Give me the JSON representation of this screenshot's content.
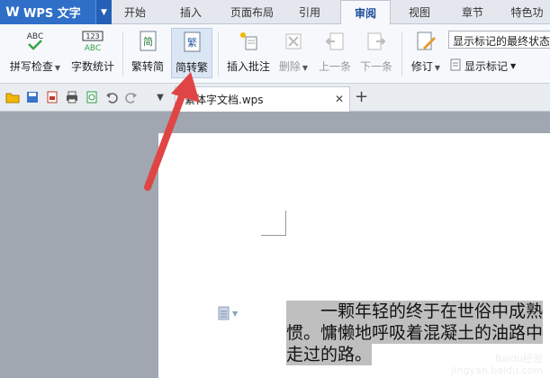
{
  "app": {
    "name": "WPS 文字",
    "logo": "W"
  },
  "menu_tabs": [
    {
      "label": "开始"
    },
    {
      "label": "插入"
    },
    {
      "label": "页面布局"
    },
    {
      "label": "引用"
    },
    {
      "label": "审阅"
    },
    {
      "label": "视图"
    },
    {
      "label": "章节"
    },
    {
      "label": "特色功"
    }
  ],
  "active_tab": "审阅",
  "ribbon": {
    "spell_check": "拼写检查",
    "word_count": "字数统计",
    "to_traditional": "繁转简",
    "to_simplified": "简转繁",
    "insert_comment": "插入批注",
    "delete": "删除",
    "prev": "上一条",
    "next": "下一条",
    "revise": "修订",
    "show_markup_select": "显示标记的最终状态",
    "show_markup": "显示标记",
    "icon_abc": "ABC",
    "icon_123": "123",
    "icon_jian": "简",
    "icon_fan": "繁"
  },
  "doc_tab": {
    "title": "繁体字文档.wps"
  },
  "document": {
    "lines": [
      "　　一颗年轻的终于在世俗中成熟",
      "惯。慵懒地呼吸着混凝土的油路中",
      "走过的路。"
    ]
  },
  "watermark": {
    "line1": "Baidu经验",
    "line2": "jingyan.baidu.com"
  },
  "colors": {
    "accent": "#2f6fc7",
    "arrow": "#e04545",
    "highlight": "#bfbfbf"
  }
}
